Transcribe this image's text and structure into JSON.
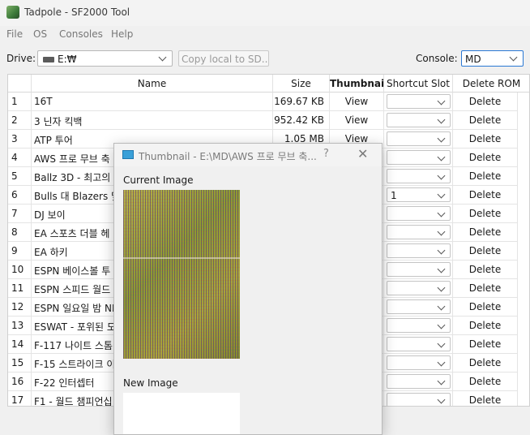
{
  "app": {
    "title": "Tadpole - SF2000 Tool"
  },
  "menu": [
    "File",
    "OS",
    "Consoles",
    "Help"
  ],
  "toolbar": {
    "drive_label": "Drive:",
    "drive_value": "E:₩",
    "copy_button": "Copy local to SD...",
    "console_label": "Console:",
    "console_value": "MD"
  },
  "table": {
    "headers": {
      "name": "Name",
      "size": "Size",
      "thumbnail": "Thumbnail",
      "slot": "Shortcut Slot",
      "delete": "Delete ROM"
    },
    "rows": [
      {
        "num": "1",
        "name": "16T",
        "size": "169.67 KB",
        "thumb": "View",
        "slot": "",
        "del": "Delete"
      },
      {
        "num": "2",
        "name": "3 닌자 킥백",
        "size": "952.42 KB",
        "thumb": "View",
        "slot": "",
        "del": "Delete"
      },
      {
        "num": "3",
        "name": "ATP 투어",
        "size": "1.05 MB",
        "thumb": "View",
        "slot": "",
        "del": "Delete"
      },
      {
        "num": "4",
        "name": "AWS 프로 무브 축",
        "size": "",
        "thumb": "",
        "slot": "",
        "del": "Delete"
      },
      {
        "num": "5",
        "name": "Ballz 3D - 최고의",
        "size": "",
        "thumb": "",
        "slot": "",
        "del": "Delete"
      },
      {
        "num": "6",
        "name": "Bulls 대 Blazers 및",
        "size": "",
        "thumb": "",
        "slot": "1",
        "del": "Delete"
      },
      {
        "num": "7",
        "name": "DJ 보이",
        "size": "",
        "thumb": "",
        "slot": "",
        "del": "Delete"
      },
      {
        "num": "8",
        "name": "EA 스포츠 더블 헤",
        "size": "",
        "thumb": "",
        "slot": "",
        "del": "Delete"
      },
      {
        "num": "9",
        "name": "EA 하키",
        "size": "",
        "thumb": "",
        "slot": "",
        "del": "Delete"
      },
      {
        "num": "10",
        "name": "ESPN 베이스볼 투",
        "size": "",
        "thumb": "",
        "slot": "",
        "del": "Delete"
      },
      {
        "num": "11",
        "name": "ESPN 스피드 월드",
        "size": "",
        "thumb": "",
        "slot": "",
        "del": "Delete"
      },
      {
        "num": "12",
        "name": "ESPN 일요일 밤 NI",
        "size": "",
        "thumb": "",
        "slot": "",
        "del": "Delete"
      },
      {
        "num": "13",
        "name": "ESWAT - 포위된 도",
        "size": "",
        "thumb": "",
        "slot": "",
        "del": "Delete"
      },
      {
        "num": "14",
        "name": "F-117 나이트 스톰",
        "size": "",
        "thumb": "",
        "slot": "",
        "del": "Delete"
      },
      {
        "num": "15",
        "name": "F-15 스트라이크 이",
        "size": "",
        "thumb": "",
        "slot": "",
        "del": "Delete"
      },
      {
        "num": "16",
        "name": "F-22 인터셉터",
        "size": "",
        "thumb": "",
        "slot": "",
        "del": "Delete"
      },
      {
        "num": "17",
        "name": "F1 - 월드 챔피언십",
        "size": "",
        "thumb": "",
        "slot": "",
        "del": "Delete"
      }
    ]
  },
  "dialog": {
    "title": "Thumbnail - E:\\MD\\AWS 프로 무브 축...",
    "help": "?",
    "close": "✕",
    "current_label": "Current Image",
    "new_label": "New Image"
  }
}
